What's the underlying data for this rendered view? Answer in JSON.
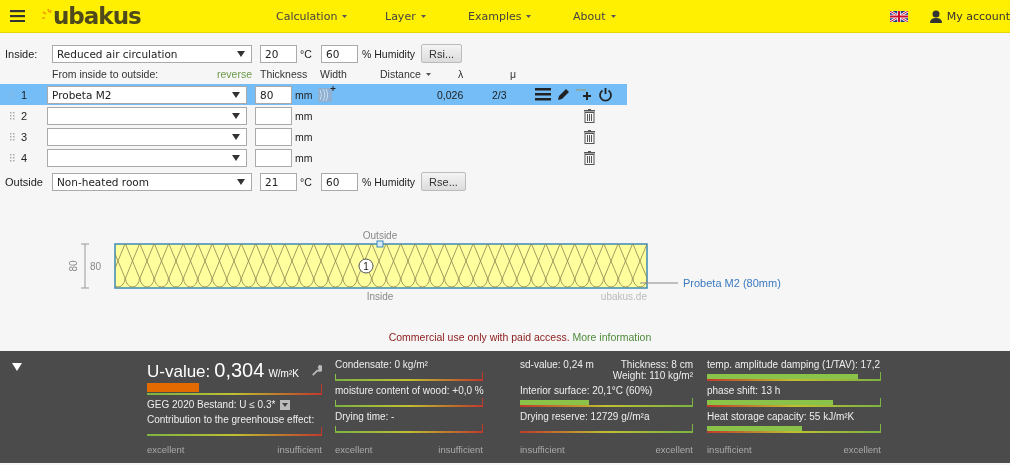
{
  "header": {
    "brand": "ubakus",
    "menu": [
      {
        "label": "Calculation"
      },
      {
        "label": "Layer"
      },
      {
        "label": "Examples"
      },
      {
        "label": "About"
      }
    ],
    "account": "My account"
  },
  "inside": {
    "label": "Inside:",
    "condition": "Reduced air circulation",
    "temperature": "20",
    "temp_unit": "°C",
    "humidity": "60",
    "humidity_unit": "% Humidity",
    "button": "Rsi..."
  },
  "columns": {
    "from": "From inside to outside:",
    "reverse": "reverse",
    "thickness": "Thickness",
    "width": "Width",
    "distance": "Distance",
    "lambda": "λ",
    "mu": "μ"
  },
  "layers": [
    {
      "number": "1",
      "material": "Probeta M2",
      "thickness": "80",
      "unit": "mm",
      "lambda": "0,026",
      "mu": "2/3",
      "selected": true
    },
    {
      "number": "2",
      "unit": "mm",
      "selected": false
    },
    {
      "number": "3",
      "unit": "mm",
      "selected": false
    },
    {
      "number": "4",
      "unit": "mm",
      "selected": false
    }
  ],
  "outside": {
    "label": "Outside",
    "condition": "Non-heated room",
    "temperature": "21",
    "temp_unit": "°C",
    "humidity": "60",
    "humidity_unit": "% Humidity",
    "button": "Rse..."
  },
  "diagram": {
    "top_label": "Outside",
    "bottom_label": "Inside",
    "dimension": "80",
    "dimension_rotated": "80",
    "marker": "1",
    "site": "ubakus.de",
    "callout": "Probeta M2 (80mm)"
  },
  "notice": {
    "text": "Commercial use only with paid access.",
    "link": "More information"
  },
  "results": {
    "columns": [
      {
        "scale_left": "excellent",
        "scale_right": "insufficient",
        "kind": "descending",
        "items": [
          {
            "kind": "headline",
            "label": "U-value:",
            "value": "0,304",
            "unit": "W/m²K",
            "level": 0.3
          },
          {
            "kind": "standard",
            "label": "GEG 2020 Bestand: U ≤ 0.3*"
          },
          {
            "kind": "meter",
            "label": "Contribution to the greenhouse effect:"
          }
        ]
      },
      {
        "scale_left": "excellent",
        "scale_right": "insufficient",
        "kind": "descending",
        "items": [
          {
            "kind": "meter",
            "label": "Condensate: 0 kg/m²",
            "level": 0.01
          },
          {
            "kind": "meter",
            "label": "moisture content of wood: +0,0 %",
            "level": 0.01
          },
          {
            "kind": "meter",
            "label": "Drying time: -",
            "level": 0.01
          }
        ]
      },
      {
        "scale_left": "insufficient",
        "scale_right": "excellent",
        "kind": "ascending",
        "items": [
          {
            "kind": "pair",
            "label": "sd-value: 0,24 m",
            "right": [
              "Thickness: 8 cm",
              "Weight: 110 kg/m²"
            ]
          },
          {
            "kind": "meter",
            "label": "Interior surface: 20,1°C (60%)",
            "level": 0.4
          },
          {
            "kind": "meter",
            "label": "Drying reserve: 12729 g//m²a"
          }
        ]
      },
      {
        "scale_left": "insufficient",
        "scale_right": "excellent",
        "kind": "ascending",
        "items": [
          {
            "kind": "meter",
            "label": "temp. amplitude damping (1/TAV): 17,2",
            "level": 0.87
          },
          {
            "kind": "meter",
            "label": "phase shift: 13 h",
            "level": 0.73
          },
          {
            "kind": "meter",
            "label": "Heat storage capacity: 55 kJ/m²K",
            "level": 0.55
          }
        ]
      }
    ]
  }
}
